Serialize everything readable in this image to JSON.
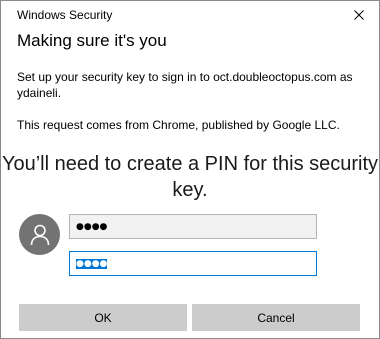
{
  "window": {
    "title": "Windows Security"
  },
  "dialog": {
    "heading": "Making sure it's you",
    "description": "Set up your security key to sign in to oct.doubleoctopus.com as ydaineli.",
    "request_info": "This request comes from Chrome, published by Google LLC.",
    "instruction": "You’ll need to create a PIN for this security key."
  },
  "pin_fields": {
    "new_pin_value": "●●●●",
    "confirm_pin_value": "●●●●"
  },
  "buttons": {
    "ok_label": "OK",
    "cancel_label": "Cancel"
  },
  "icons": {
    "close": "close-icon",
    "avatar": "user-icon"
  },
  "colors": {
    "accent": "#0078d7",
    "button_bg": "#cccccc",
    "avatar_bg": "#737373"
  }
}
